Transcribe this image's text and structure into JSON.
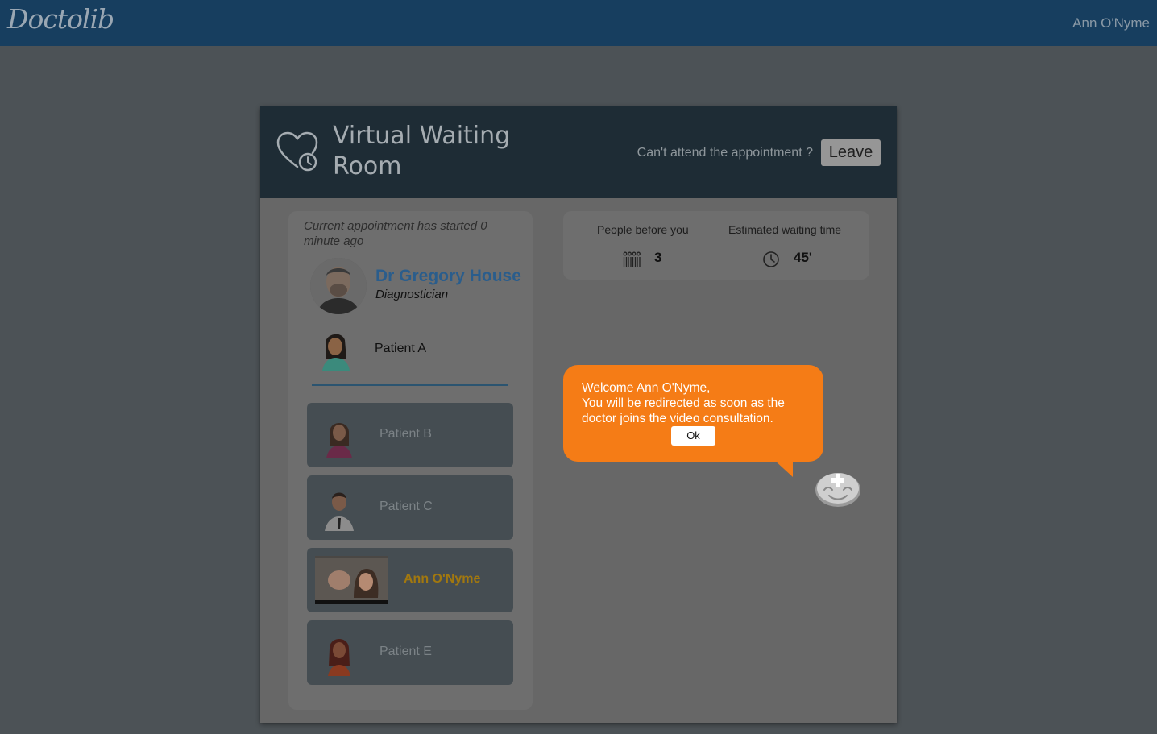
{
  "app": {
    "logo_text": "Doctolib",
    "user_name": "Ann O'Nyme"
  },
  "header": {
    "title": "Virtual Waiting Room",
    "cant_attend": "Can't attend the appointment ?",
    "leave_label": "Leave"
  },
  "appointment": {
    "started_text": "Current appointment has started 0 minute ago",
    "doctor_name": "Dr Gregory House",
    "doctor_specialty": "Diagnostician",
    "current_patient": "Patient A"
  },
  "queue": [
    {
      "name": "Patient B",
      "avatar": "female-patient-avatar",
      "is_self": false
    },
    {
      "name": "Patient C",
      "avatar": "male-patient-avatar",
      "is_self": false
    },
    {
      "name": "Ann O'Nyme",
      "avatar": "webcam-video",
      "is_self": true
    },
    {
      "name": "Patient E",
      "avatar": "female-patient-avatar",
      "is_self": false
    }
  ],
  "stats": {
    "people_before_label": "People before you",
    "people_before_value": "3",
    "people_icon": "people-queue-icon",
    "wait_label": "Estimated waiting time",
    "wait_value": "45'",
    "wait_icon": "clock-icon"
  },
  "bubble": {
    "line1": "Welcome Ann O'Nyme,",
    "line2": "You will be redirected as soon as the doctor joins the video consultation.",
    "ok_label": "Ok"
  },
  "colors": {
    "topbar": "#173e5f",
    "card_header": "#1e2c35",
    "bubble": "#f57c16",
    "doctor_name": "#2a5d8c",
    "self_name": "#a2780e"
  }
}
